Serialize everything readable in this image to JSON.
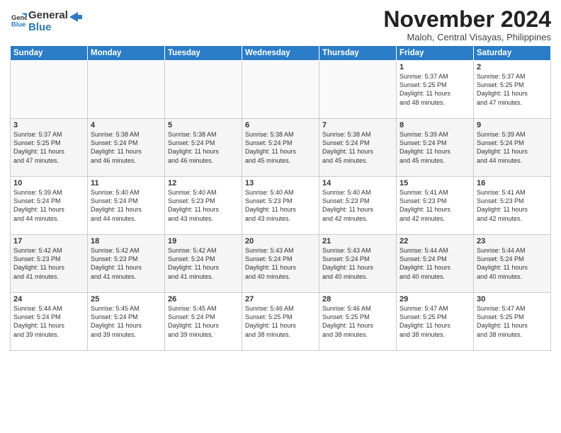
{
  "logo": {
    "line1": "General",
    "line2": "Blue"
  },
  "title": "November 2024",
  "location": "Maloh, Central Visayas, Philippines",
  "weekdays": [
    "Sunday",
    "Monday",
    "Tuesday",
    "Wednesday",
    "Thursday",
    "Friday",
    "Saturday"
  ],
  "weeks": [
    [
      {
        "day": "",
        "info": ""
      },
      {
        "day": "",
        "info": ""
      },
      {
        "day": "",
        "info": ""
      },
      {
        "day": "",
        "info": ""
      },
      {
        "day": "",
        "info": ""
      },
      {
        "day": "1",
        "info": "Sunrise: 5:37 AM\nSunset: 5:25 PM\nDaylight: 11 hours\nand 48 minutes."
      },
      {
        "day": "2",
        "info": "Sunrise: 5:37 AM\nSunset: 5:25 PM\nDaylight: 11 hours\nand 47 minutes."
      }
    ],
    [
      {
        "day": "3",
        "info": "Sunrise: 5:37 AM\nSunset: 5:25 PM\nDaylight: 11 hours\nand 47 minutes."
      },
      {
        "day": "4",
        "info": "Sunrise: 5:38 AM\nSunset: 5:24 PM\nDaylight: 11 hours\nand 46 minutes."
      },
      {
        "day": "5",
        "info": "Sunrise: 5:38 AM\nSunset: 5:24 PM\nDaylight: 11 hours\nand 46 minutes."
      },
      {
        "day": "6",
        "info": "Sunrise: 5:38 AM\nSunset: 5:24 PM\nDaylight: 11 hours\nand 45 minutes."
      },
      {
        "day": "7",
        "info": "Sunrise: 5:38 AM\nSunset: 5:24 PM\nDaylight: 11 hours\nand 45 minutes."
      },
      {
        "day": "8",
        "info": "Sunrise: 5:39 AM\nSunset: 5:24 PM\nDaylight: 11 hours\nand 45 minutes."
      },
      {
        "day": "9",
        "info": "Sunrise: 5:39 AM\nSunset: 5:24 PM\nDaylight: 11 hours\nand 44 minutes."
      }
    ],
    [
      {
        "day": "10",
        "info": "Sunrise: 5:39 AM\nSunset: 5:24 PM\nDaylight: 11 hours\nand 44 minutes."
      },
      {
        "day": "11",
        "info": "Sunrise: 5:40 AM\nSunset: 5:24 PM\nDaylight: 11 hours\nand 44 minutes."
      },
      {
        "day": "12",
        "info": "Sunrise: 5:40 AM\nSunset: 5:23 PM\nDaylight: 11 hours\nand 43 minutes."
      },
      {
        "day": "13",
        "info": "Sunrise: 5:40 AM\nSunset: 5:23 PM\nDaylight: 11 hours\nand 43 minutes."
      },
      {
        "day": "14",
        "info": "Sunrise: 5:40 AM\nSunset: 5:23 PM\nDaylight: 11 hours\nand 42 minutes."
      },
      {
        "day": "15",
        "info": "Sunrise: 5:41 AM\nSunset: 5:23 PM\nDaylight: 11 hours\nand 42 minutes."
      },
      {
        "day": "16",
        "info": "Sunrise: 5:41 AM\nSunset: 5:23 PM\nDaylight: 11 hours\nand 42 minutes."
      }
    ],
    [
      {
        "day": "17",
        "info": "Sunrise: 5:42 AM\nSunset: 5:23 PM\nDaylight: 11 hours\nand 41 minutes."
      },
      {
        "day": "18",
        "info": "Sunrise: 5:42 AM\nSunset: 5:23 PM\nDaylight: 11 hours\nand 41 minutes."
      },
      {
        "day": "19",
        "info": "Sunrise: 5:42 AM\nSunset: 5:24 PM\nDaylight: 11 hours\nand 41 minutes."
      },
      {
        "day": "20",
        "info": "Sunrise: 5:43 AM\nSunset: 5:24 PM\nDaylight: 11 hours\nand 40 minutes."
      },
      {
        "day": "21",
        "info": "Sunrise: 5:43 AM\nSunset: 5:24 PM\nDaylight: 11 hours\nand 40 minutes."
      },
      {
        "day": "22",
        "info": "Sunrise: 5:44 AM\nSunset: 5:24 PM\nDaylight: 11 hours\nand 40 minutes."
      },
      {
        "day": "23",
        "info": "Sunrise: 5:44 AM\nSunset: 5:24 PM\nDaylight: 11 hours\nand 40 minutes."
      }
    ],
    [
      {
        "day": "24",
        "info": "Sunrise: 5:44 AM\nSunset: 5:24 PM\nDaylight: 11 hours\nand 39 minutes."
      },
      {
        "day": "25",
        "info": "Sunrise: 5:45 AM\nSunset: 5:24 PM\nDaylight: 11 hours\nand 39 minutes."
      },
      {
        "day": "26",
        "info": "Sunrise: 5:45 AM\nSunset: 5:24 PM\nDaylight: 11 hours\nand 39 minutes."
      },
      {
        "day": "27",
        "info": "Sunrise: 5:46 AM\nSunset: 5:25 PM\nDaylight: 11 hours\nand 38 minutes."
      },
      {
        "day": "28",
        "info": "Sunrise: 5:46 AM\nSunset: 5:25 PM\nDaylight: 11 hours\nand 38 minutes."
      },
      {
        "day": "29",
        "info": "Sunrise: 5:47 AM\nSunset: 5:25 PM\nDaylight: 11 hours\nand 38 minutes."
      },
      {
        "day": "30",
        "info": "Sunrise: 5:47 AM\nSunset: 5:25 PM\nDaylight: 11 hours\nand 38 minutes."
      }
    ]
  ]
}
